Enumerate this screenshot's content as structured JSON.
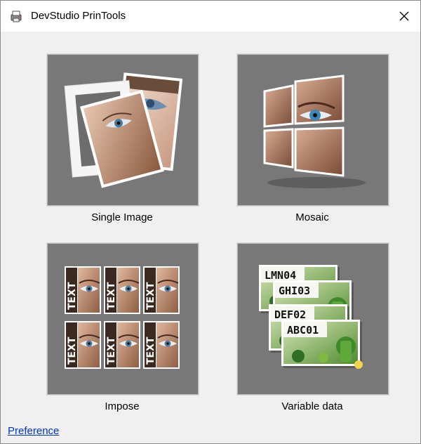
{
  "window": {
    "title": "DevStudio PrinTools",
    "app_icon": "printer-app-icon",
    "close_icon": "close-icon"
  },
  "tiles": [
    {
      "label": "Single Image",
      "icon": "single-image-icon"
    },
    {
      "label": "Mosaic",
      "icon": "mosaic-icon"
    },
    {
      "label": "Impose",
      "icon": "impose-icon"
    },
    {
      "label": "Variable data",
      "icon": "variable-data-icon"
    }
  ],
  "impose_tile": {
    "repeated_text": "TEXT"
  },
  "variable_data_tile": {
    "cards": [
      "LMN04",
      "GHI03",
      "DEF02",
      "ABC01"
    ]
  },
  "footer": {
    "preference_link": "Preference"
  },
  "colors": {
    "tile_background": "#787878",
    "link": "#0033cc"
  }
}
